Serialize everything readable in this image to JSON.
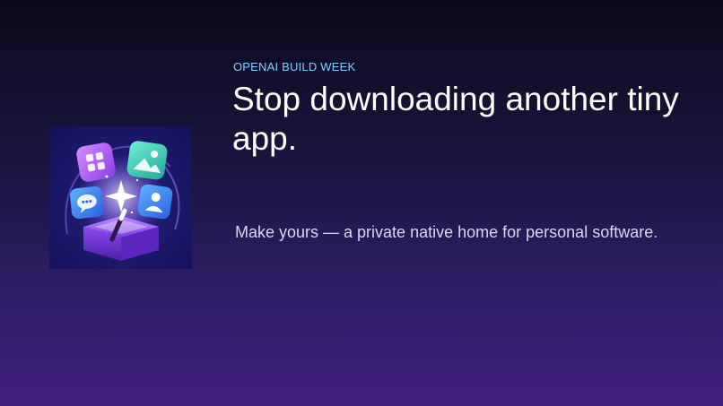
{
  "slide": {
    "kicker": "OPENAI BUILD WEEK",
    "headline": "Stop downloading another tiny app.",
    "tagline": "Make yours — a private native home for personal software."
  },
  "app_art": {
    "icons": [
      "grid-app-icon",
      "photo-app-icon",
      "chat-app-icon",
      "person-app-icon",
      "magic-wand-icon",
      "sparkle-icon",
      "open-box-icon"
    ]
  },
  "colors": {
    "kicker": "#7fd0ff",
    "headline": "#ffffff",
    "tagline": "#ddd6f5",
    "background_top": "#0c0b1c",
    "background_bottom": "#40217d"
  }
}
